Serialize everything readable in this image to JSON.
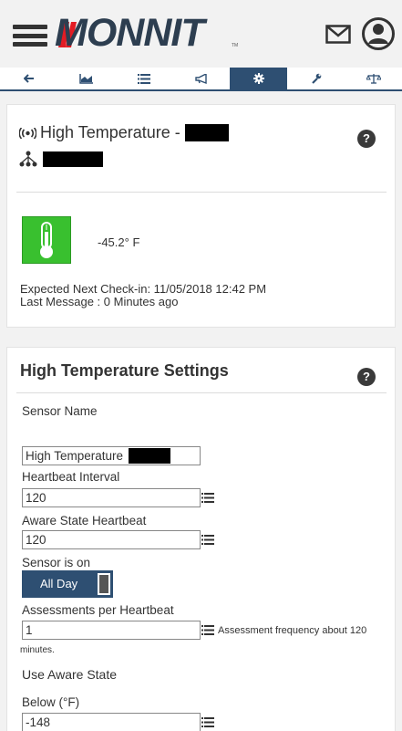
{
  "header": {
    "logo_text": "MONNIT",
    "logo_tm": "TM",
    "menu_icon": "hamburger-menu-icon",
    "mail_icon": "mail-icon",
    "user_icon": "user-account-icon"
  },
  "tabs": [
    {
      "icon": "back-arrow-icon",
      "active": false
    },
    {
      "icon": "chart-icon",
      "active": false
    },
    {
      "icon": "list-icon",
      "active": false
    },
    {
      "icon": "megaphone-icon",
      "active": false
    },
    {
      "icon": "gear-icon",
      "active": true
    },
    {
      "icon": "wrench-icon",
      "active": false
    },
    {
      "icon": "scale-icon",
      "active": false
    }
  ],
  "sensor_card": {
    "title": "High Temperature -",
    "reading": "-45.2° F",
    "expected_checkin": "Expected Next Check-in: 11/05/2018 12:42 PM",
    "last_message": "Last Message : 0 Minutes ago",
    "help": "?"
  },
  "settings": {
    "title": "High Temperature Settings",
    "help": "?",
    "sensor_name_label": "Sensor Name",
    "sensor_name_value": "High Temperature",
    "heartbeat_label": "Heartbeat Interval",
    "heartbeat_value": "120",
    "aware_heartbeat_label": "Aware State Heartbeat",
    "aware_heartbeat_value": "120",
    "sensor_on_label": "Sensor is on",
    "sensor_on_value": "All Day",
    "assessments_label": "Assessments per Heartbeat",
    "assessments_value": "1",
    "assessment_note": "Assessment frequency about 120",
    "assessment_note_cont": "minutes.",
    "use_aware_label": "Use Aware State",
    "below_label": "Below (°F)",
    "below_value": "-148"
  },
  "colors": {
    "accent": "#2e4f72",
    "status_ok": "#39c02f",
    "brand_red": "#e21c24"
  }
}
